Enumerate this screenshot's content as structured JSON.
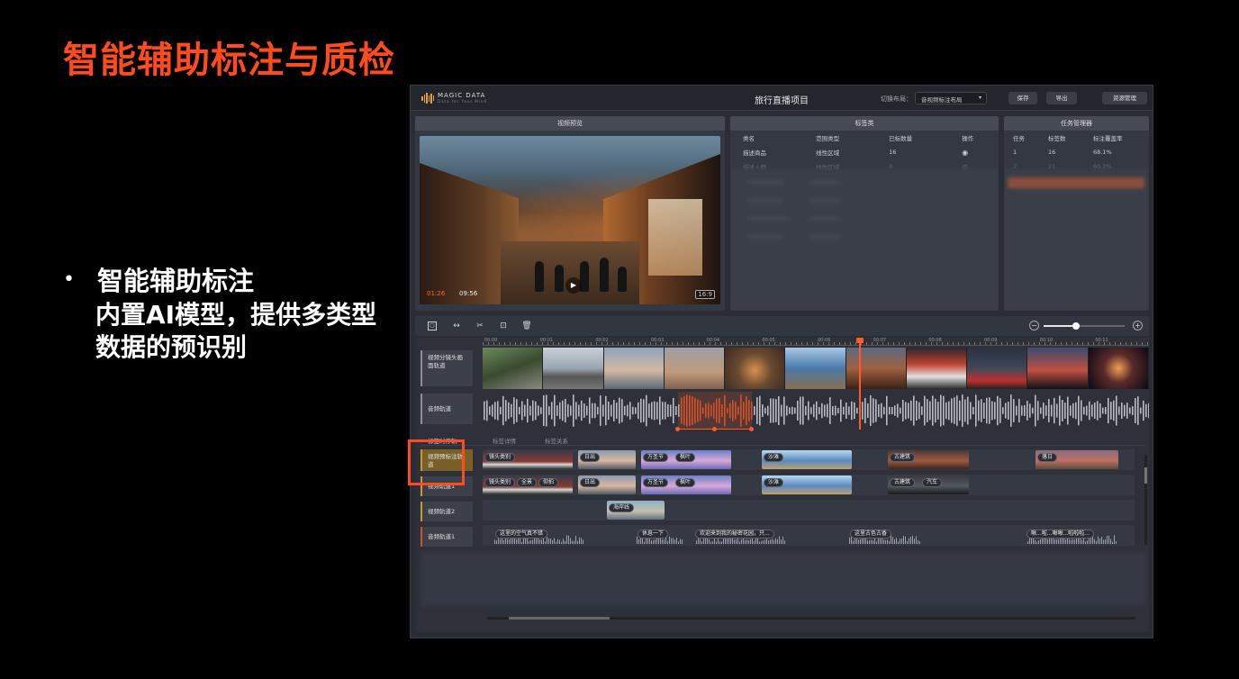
{
  "slide": {
    "title": "智能辅助标注与质检",
    "bullet_head": "智能辅助标注",
    "bullet_desc": "内置AI模型，提供多类型数据的预识别"
  },
  "app": {
    "logo_text": "MAGIC DATA",
    "logo_sub": "Data for Your Mind",
    "title": "旅行直播项目",
    "layout_label": "切换布局：",
    "layout_value": "音视频标注布局",
    "buttons": {
      "save": "保存",
      "export": "导出",
      "resources": "资源管理"
    }
  },
  "video_panel": {
    "title": "视频预览",
    "current_time": "01:26",
    "total_time": "09:56",
    "aspect": "16:9"
  },
  "label_panel": {
    "title": "标签类",
    "columns": [
      "类名",
      "范围类型",
      "已标数量",
      "操作"
    ],
    "rows": [
      {
        "name": "描述商品",
        "range": "线性区域",
        "count": "16"
      },
      {
        "name": "描述人物",
        "range": "线性区域",
        "count": "9"
      }
    ]
  },
  "task_panel": {
    "title": "任务管理器",
    "columns": [
      "任务",
      "标签数",
      "标注覆盖率"
    ],
    "rows": [
      {
        "task": "1",
        "labels": "16",
        "coverage": "68.1%"
      },
      {
        "task": "2",
        "labels": "21",
        "coverage": "60.2%"
      }
    ]
  },
  "timeline": {
    "ruler": [
      "00:00",
      "00:01",
      "00:02",
      "00:03",
      "00:04",
      "00:05",
      "00:06",
      "00:07",
      "00:08",
      "00:09",
      "00:10",
      "00:11"
    ],
    "tracks": {
      "shot": "视频分镜头画面轨道",
      "audio": "音频轨道",
      "video_ann": "视频预标注轨道",
      "video1": "视频轨道1",
      "video2": "视频轨道2",
      "audio1": "音频轨道1"
    },
    "subtabs": {
      "t1": "标签时序轨",
      "t2": "标签详情",
      "t3": "标签关系"
    },
    "ann_tags": {
      "shot_type": "镜头类别",
      "sunrise": "日出",
      "wanshengjie": "万圣节",
      "maple": "枫叶",
      "beach": "沙滩",
      "ancient": "古建筑",
      "sunset": "落日",
      "full": "全景",
      "low_angle": "仰拍",
      "car": "汽车",
      "coast": "海岸线"
    },
    "audio_tags": {
      "a1": "这里的空气真不错",
      "a2": "休息一下",
      "a3": "欢迎来到我的秘密花园，只...",
      "a4": "这里古色古香",
      "a5": "啾...啦...啾啾...啦啦啦..."
    }
  },
  "colors": {
    "accent": "#ff4b1f",
    "playhead": "#ff5a28",
    "panel": "#343842"
  },
  "icons": [
    "select-box-icon",
    "move-icon",
    "cut-icon",
    "crop-icon",
    "trash-icon",
    "eye-icon",
    "eye-off-icon",
    "play-icon",
    "zoom-out-icon",
    "zoom-in-icon"
  ]
}
